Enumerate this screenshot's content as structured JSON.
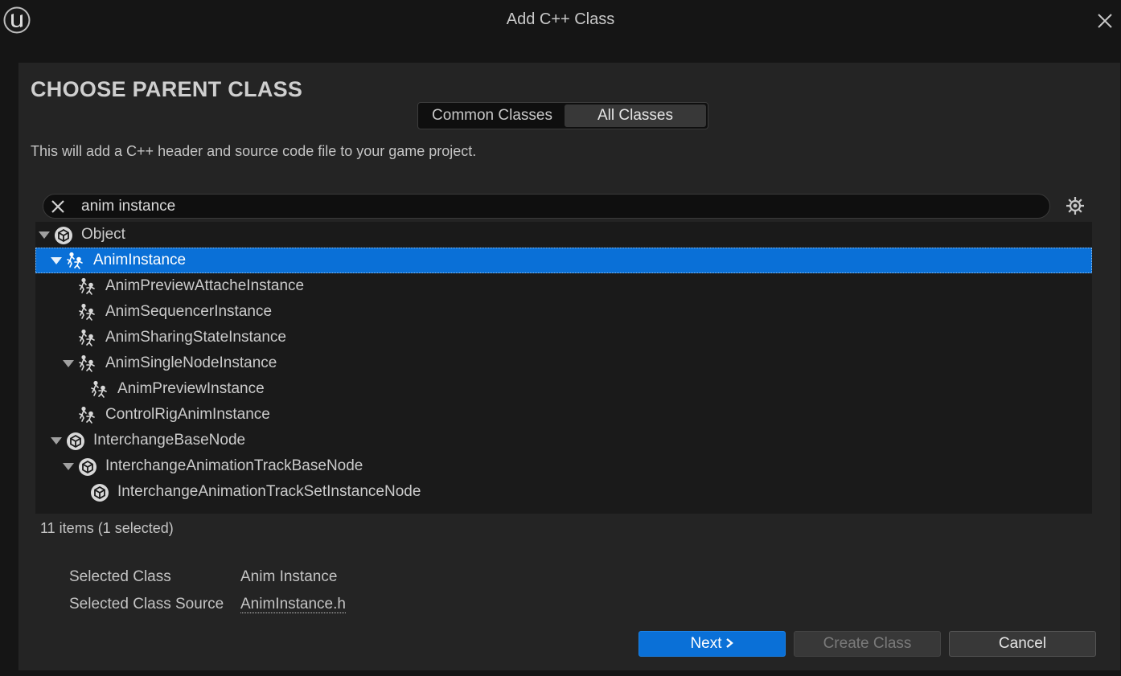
{
  "window": {
    "title": "Add C++ Class"
  },
  "heading": "CHOOSE PARENT CLASS",
  "tabs": [
    {
      "label": "Common Classes",
      "active": false
    },
    {
      "label": "All Classes",
      "active": true
    }
  ],
  "description": "This will add a C++ header and source code file to your game project.",
  "search": {
    "value": "anim instance"
  },
  "tree": [
    {
      "label": "Object",
      "icon": "object-class-icon",
      "expanded": true,
      "selected": false
    },
    {
      "label": "AnimInstance",
      "icon": "anim-class-icon",
      "expanded": true,
      "selected": true
    },
    {
      "label": "AnimPreviewAttacheInstance",
      "icon": "anim-class-icon",
      "expanded": false,
      "selected": false
    },
    {
      "label": "AnimSequencerInstance",
      "icon": "anim-class-icon",
      "expanded": false,
      "selected": false
    },
    {
      "label": "AnimSharingStateInstance",
      "icon": "anim-class-icon",
      "expanded": false,
      "selected": false
    },
    {
      "label": "AnimSingleNodeInstance",
      "icon": "anim-class-icon",
      "expanded": true,
      "selected": false
    },
    {
      "label": "AnimPreviewInstance",
      "icon": "anim-class-icon",
      "expanded": false,
      "selected": false
    },
    {
      "label": "ControlRigAnimInstance",
      "icon": "anim-class-icon",
      "expanded": false,
      "selected": false
    },
    {
      "label": "InterchangeBaseNode",
      "icon": "object-class-icon",
      "expanded": true,
      "selected": false
    },
    {
      "label": "InterchangeAnimationTrackBaseNode",
      "icon": "object-class-icon",
      "expanded": true,
      "selected": false
    },
    {
      "label": "InterchangeAnimationTrackSetInstanceNode",
      "icon": "object-class-icon",
      "expanded": false,
      "selected": false
    }
  ],
  "item_count": "11 items (1 selected)",
  "info": {
    "selected_class_label": "Selected Class",
    "selected_class_value": "Anim Instance",
    "source_label": "Selected Class Source",
    "source_value": "AnimInstance.h"
  },
  "buttons": {
    "next": "Next",
    "create": "Create Class",
    "cancel": "Cancel"
  },
  "colors": {
    "accent": "#0a70d7",
    "background": "#242424",
    "tree_background": "#1a1a1a"
  }
}
